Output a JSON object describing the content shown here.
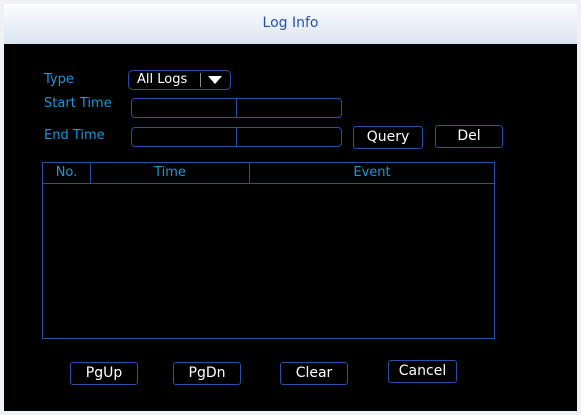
{
  "window": {
    "title": "Log Info"
  },
  "filters": {
    "type_label": "Type",
    "type_value": "All Logs",
    "start_label": "Start  Time",
    "end_label": "End Time"
  },
  "buttons": {
    "query": "Query",
    "del": "Del",
    "pgup": "PgUp",
    "pgdn": "PgDn",
    "clear": "Clear",
    "cancel": "Cancel"
  },
  "table": {
    "columns": [
      "No.",
      "Time",
      "Event"
    ],
    "rows": []
  },
  "colors": {
    "label": "#1e95d8",
    "border": "#2b4fa6",
    "title": "#2a4fa7"
  }
}
